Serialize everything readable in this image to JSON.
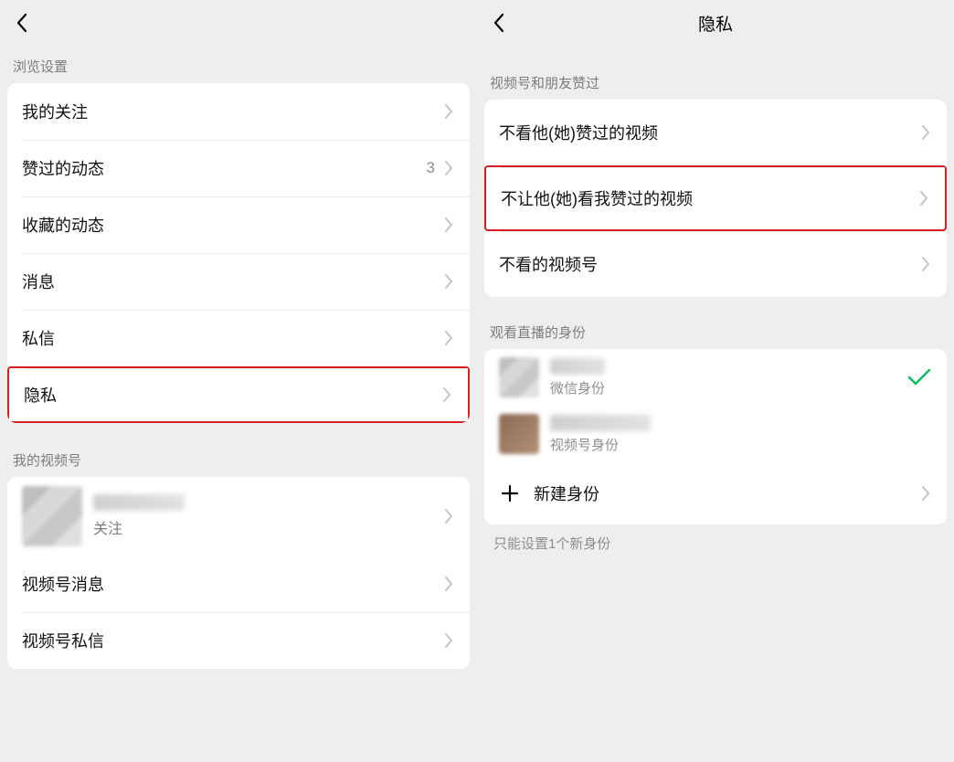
{
  "left": {
    "section_browse": "浏览设置",
    "items": {
      "follow": "我的关注",
      "liked": "赞过的动态",
      "liked_count": "3",
      "fav": "收藏的动态",
      "msg": "消息",
      "dm": "私信",
      "privacy": "隐私"
    },
    "section_channel": "我的视频号",
    "profile_sub": "关注",
    "channel_msg": "视频号消息",
    "channel_dm": "视频号私信"
  },
  "right": {
    "title": "隐私",
    "section_video": "视频号和朋友赞过",
    "items": {
      "not_see": "不看他(她)赞过的视频",
      "not_let": "不让他(她)看我赞过的视频",
      "not_watch": "不看的视频号"
    },
    "section_identity": "观看直播的身份",
    "identity_wechat": "微信身份",
    "identity_channel": "视频号身份",
    "new_identity": "新建身份",
    "footer": "只能设置1个新身份"
  }
}
